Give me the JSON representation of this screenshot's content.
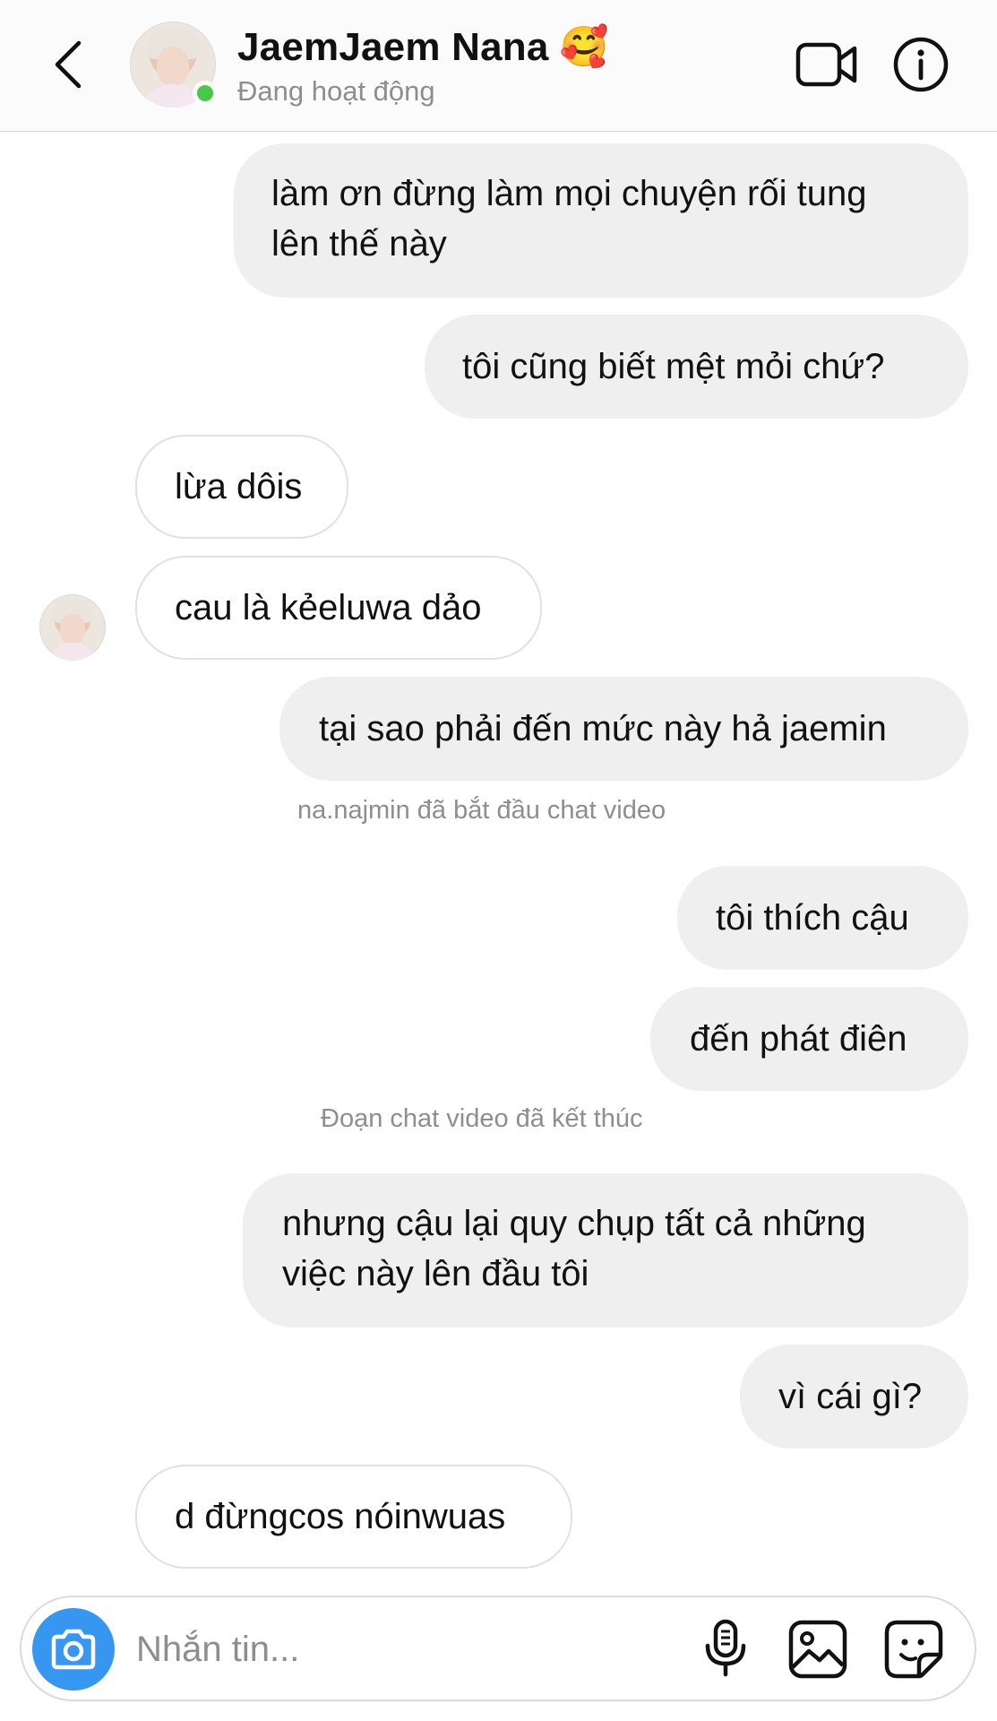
{
  "header": {
    "contact_name": "JaemJaem Nana 🥰",
    "status": "Đang hoạt động"
  },
  "colors": {
    "online": "#48c84a",
    "sent_bubble": "#efefef",
    "received_border": "#e1e1e1",
    "camera_button": "#3797f0",
    "secondary_text": "#8e8e8e"
  },
  "icons": {
    "back": "chevron-left-icon",
    "video": "video-call-icon",
    "info": "info-icon",
    "camera": "camera-icon",
    "mic": "microphone-icon",
    "gallery": "gallery-icon",
    "sticker": "sticker-icon"
  },
  "messages": [
    {
      "direction": "sent",
      "lines": [
        "làm ơn đừng làm mọi chuyện rối tung",
        "lên thế này"
      ]
    },
    {
      "direction": "sent",
      "lines": [
        "tôi cũng biết mệt mỏi chứ?"
      ]
    },
    {
      "direction": "received",
      "lines": [
        "lừa dôis"
      ]
    },
    {
      "direction": "received",
      "lines": [
        "cau là kẻeluwa dảo"
      ]
    },
    {
      "direction": "sent",
      "lines": [
        "tại sao phải đến mức này hả jaemin"
      ]
    },
    {
      "direction": "system",
      "lines": [
        "na.najmin đã bắt đầu chat video"
      ]
    },
    {
      "direction": "sent",
      "lines": [
        "tôi thích cậu"
      ]
    },
    {
      "direction": "sent",
      "lines": [
        "đến phát điên"
      ]
    },
    {
      "direction": "system",
      "lines": [
        "Đoạn chat video đã kết thúc"
      ]
    },
    {
      "direction": "sent",
      "lines": [
        "nhưng cậu lại quy chụp tất cả những",
        "việc này lên đầu tôi"
      ]
    },
    {
      "direction": "sent",
      "lines": [
        "vì cái gì?"
      ]
    },
    {
      "direction": "received",
      "lines": [
        "d đừngcos nóinwuas"
      ]
    }
  ],
  "composer": {
    "placeholder": "Nhắn tin..."
  }
}
